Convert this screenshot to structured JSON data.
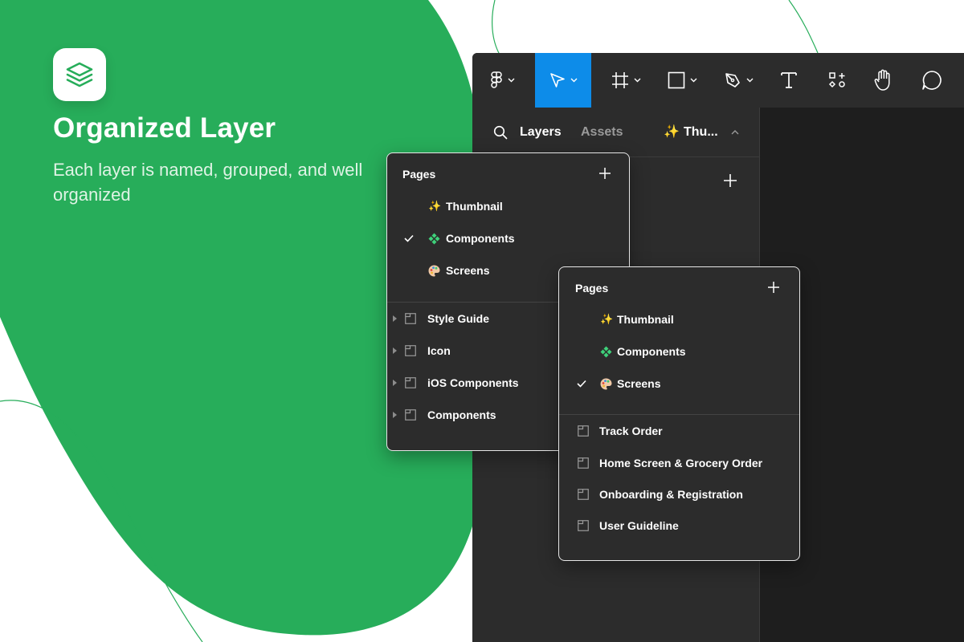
{
  "colors": {
    "brand_green": "#27ad5a",
    "active_tool": "#0d8ce9",
    "panel_bg": "#2c2c2c",
    "canvas_bg": "#1e1e1e"
  },
  "hero": {
    "icon": "layers-icon",
    "title": "Organized Layer",
    "subtitle": "Each layer is named, grouped, and well organized"
  },
  "toolbar": {
    "tools": [
      {
        "icon": "figma-menu-icon",
        "dropdown": true
      },
      {
        "icon": "move-pointer-icon",
        "dropdown": true,
        "active": true
      },
      {
        "icon": "frame-icon",
        "dropdown": true
      },
      {
        "icon": "rectangle-icon",
        "dropdown": true
      },
      {
        "icon": "pen-icon",
        "dropdown": true
      },
      {
        "icon": "text-icon",
        "dropdown": false
      },
      {
        "icon": "resources-icon",
        "dropdown": false
      },
      {
        "icon": "hand-icon",
        "dropdown": false
      },
      {
        "icon": "comment-icon",
        "dropdown": false
      }
    ]
  },
  "panel": {
    "tabs": {
      "layers": "Layers",
      "assets": "Assets",
      "current_page": "Thu..."
    }
  },
  "popup_a": {
    "title": "Pages",
    "pages": [
      {
        "label": "Thumbnail",
        "emoji": "sparkles-icon",
        "checked": false
      },
      {
        "label": "Components",
        "emoji": "component-icon",
        "checked": true
      },
      {
        "label": "Screens",
        "emoji": "palette-icon",
        "checked": false
      }
    ],
    "layers": [
      {
        "label": "Style Guide"
      },
      {
        "label": "Icon"
      },
      {
        "label": "iOS Components"
      },
      {
        "label": "Components"
      }
    ]
  },
  "popup_b": {
    "title": "Pages",
    "pages": [
      {
        "label": "Thumbnail",
        "emoji": "sparkles-icon",
        "checked": false
      },
      {
        "label": "Components",
        "emoji": "component-icon",
        "checked": false
      },
      {
        "label": "Screens",
        "emoji": "palette-icon",
        "checked": true
      }
    ],
    "layers": [
      {
        "label": "Track Order"
      },
      {
        "label": "Home Screen & Grocery Order"
      },
      {
        "label": "Onboarding & Registration"
      },
      {
        "label": "User Guideline"
      }
    ]
  }
}
